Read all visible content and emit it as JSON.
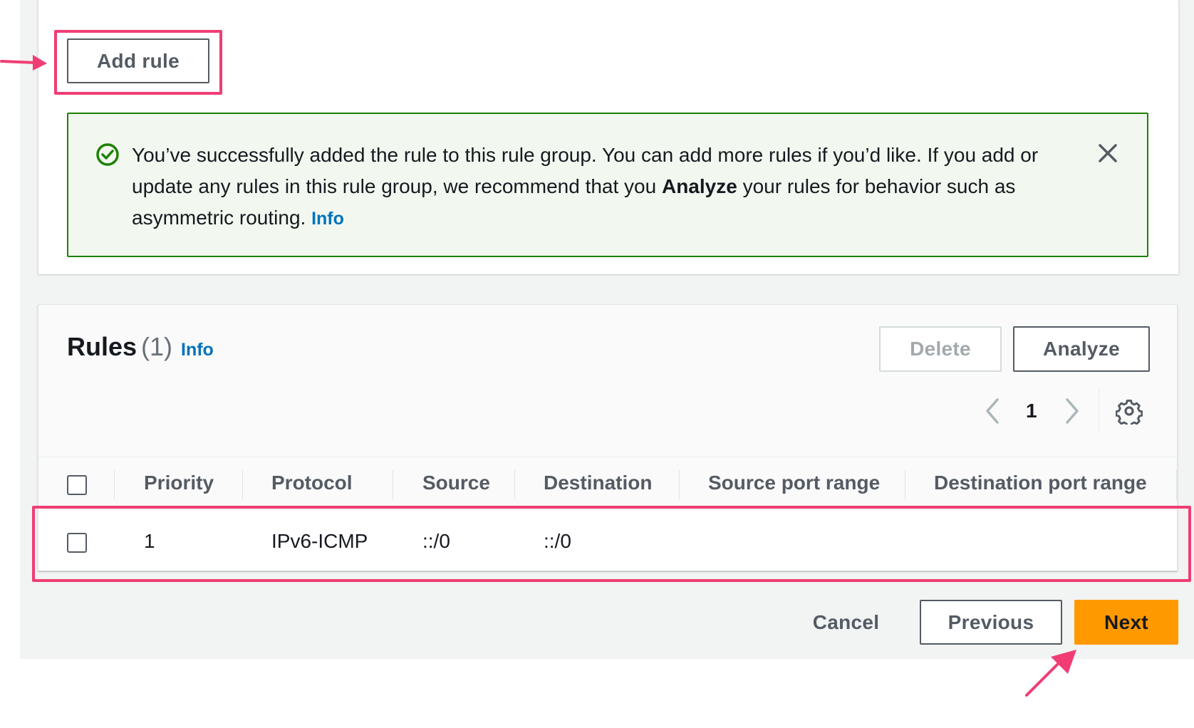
{
  "add_rule_button": "Add rule",
  "alert": {
    "text_part1": "You’ve successfully added the rule to this rule group. You can add more rules if you’d like. If you add or update any rules in this rule group, we recommend that you ",
    "bold": "Analyze",
    "text_part2": " your rules for behavior such as asymmetric routing. ",
    "info": "Info",
    "close_icon": "close-icon",
    "status_icon": "success-check-icon",
    "color": "#1d8102"
  },
  "rules": {
    "title": "Rules",
    "count": "(1)",
    "info": "Info",
    "delete_button": "Delete",
    "analyze_button": "Analyze",
    "pagination": {
      "current_page": "1"
    },
    "columns": [
      "Priority",
      "Protocol",
      "Source",
      "Destination",
      "Source port range",
      "Destination port range"
    ],
    "rows": [
      {
        "priority": "1",
        "protocol": "IPv6-ICMP",
        "source": "::/0",
        "destination": "::/0",
        "source_port_range": "",
        "destination_port_range": ""
      }
    ]
  },
  "footer": {
    "cancel": "Cancel",
    "previous": "Previous",
    "next": "Next"
  },
  "colors": {
    "accent": "#ff9900",
    "link": "#0073bb",
    "highlight": "#f03d74",
    "success_bg": "#f2f8f0"
  }
}
